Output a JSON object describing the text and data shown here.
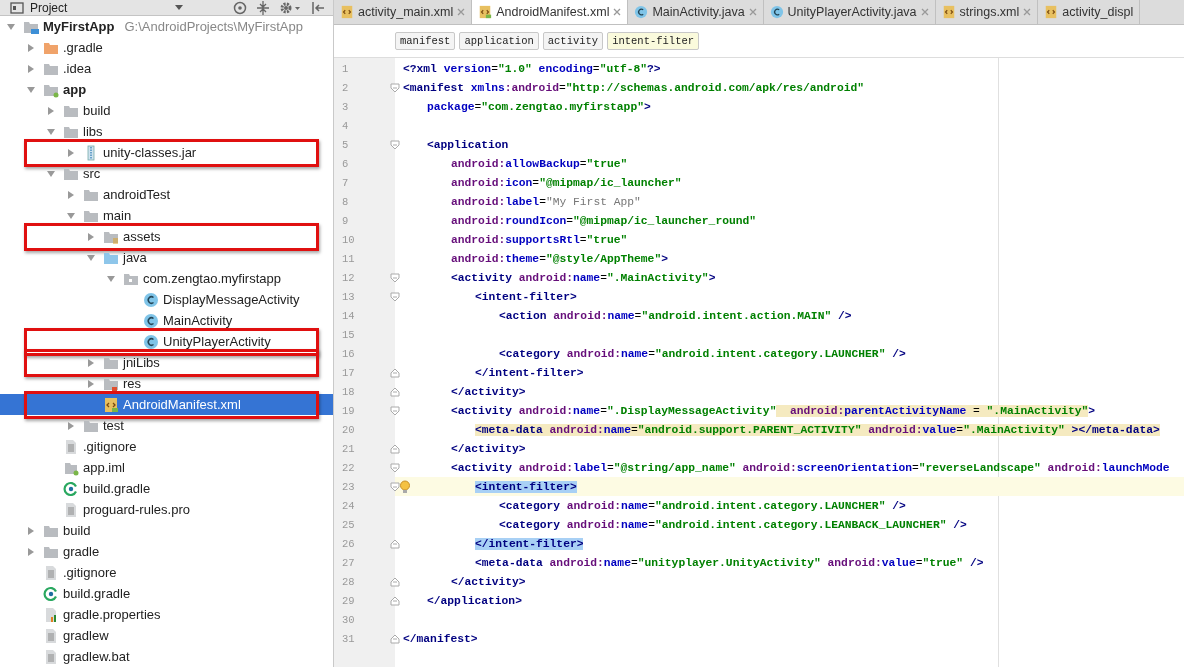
{
  "project_panel": {
    "title": "Project"
  },
  "tree": [
    {
      "label": "MyFirstApp",
      "path": "G:\\AndroidProjects\\MyFirstApp",
      "kind": "project",
      "expanded": true,
      "selected": false,
      "boxed": false,
      "children": [
        {
          "label": ".gradle",
          "kind": "folder-excluded",
          "expanded": false,
          "selected": false,
          "boxed": false
        },
        {
          "label": ".idea",
          "kind": "folder",
          "expanded": false,
          "selected": false,
          "boxed": false
        },
        {
          "label": "app",
          "kind": "module",
          "expanded": true,
          "selected": false,
          "boxed": false,
          "children": [
            {
              "label": "build",
              "kind": "folder",
              "expanded": false,
              "selected": false,
              "boxed": false
            },
            {
              "label": "libs",
              "kind": "folder",
              "expanded": true,
              "selected": false,
              "boxed": false,
              "children": [
                {
                  "label": "unity-classes.jar",
                  "kind": "jar",
                  "expanded": false,
                  "selected": false,
                  "boxed": true
                }
              ]
            },
            {
              "label": "src",
              "kind": "folder",
              "expanded": true,
              "selected": false,
              "boxed": false,
              "children": [
                {
                  "label": "androidTest",
                  "kind": "folder",
                  "expanded": false,
                  "selected": false,
                  "boxed": false
                },
                {
                  "label": "main",
                  "kind": "folder",
                  "expanded": true,
                  "selected": false,
                  "boxed": false,
                  "children": [
                    {
                      "label": "assets",
                      "kind": "assets",
                      "expanded": false,
                      "selected": false,
                      "boxed": true
                    },
                    {
                      "label": "java",
                      "kind": "source",
                      "expanded": true,
                      "selected": false,
                      "boxed": false,
                      "children": [
                        {
                          "label": "com.zengtao.myfirstapp",
                          "kind": "package",
                          "expanded": true,
                          "selected": false,
                          "boxed": false,
                          "children": [
                            {
                              "label": "DisplayMessageActivity",
                              "kind": "class",
                              "selected": false,
                              "boxed": false
                            },
                            {
                              "label": "MainActivity",
                              "kind": "class",
                              "selected": false,
                              "boxed": false
                            },
                            {
                              "label": "UnityPlayerActivity",
                              "kind": "class",
                              "selected": false,
                              "boxed": true
                            }
                          ]
                        }
                      ]
                    },
                    {
                      "label": "jniLibs",
                      "kind": "folder",
                      "expanded": false,
                      "selected": false,
                      "boxed": true
                    },
                    {
                      "label": "res",
                      "kind": "res",
                      "expanded": false,
                      "selected": false,
                      "boxed": false
                    },
                    {
                      "label": "AndroidManifest.xml",
                      "kind": "manifest",
                      "selected": true,
                      "boxed": true
                    }
                  ]
                },
                {
                  "label": "test",
                  "kind": "folder",
                  "expanded": false,
                  "selected": false,
                  "boxed": false
                }
              ]
            },
            {
              "label": ".gitignore",
              "kind": "text",
              "selected": false,
              "boxed": false
            },
            {
              "label": "app.iml",
              "kind": "iml",
              "selected": false,
              "boxed": false
            },
            {
              "label": "build.gradle",
              "kind": "gradle",
              "selected": false,
              "boxed": false
            },
            {
              "label": "proguard-rules.pro",
              "kind": "text",
              "selected": false,
              "boxed": false
            }
          ]
        },
        {
          "label": "build",
          "kind": "folder",
          "expanded": false,
          "selected": false,
          "boxed": false
        },
        {
          "label": "gradle",
          "kind": "folder",
          "expanded": false,
          "selected": false,
          "boxed": false
        },
        {
          "label": ".gitignore",
          "kind": "text",
          "selected": false,
          "boxed": false
        },
        {
          "label": "build.gradle",
          "kind": "gradle",
          "selected": false,
          "boxed": false
        },
        {
          "label": "gradle.properties",
          "kind": "properties",
          "selected": false,
          "boxed": false
        },
        {
          "label": "gradlew",
          "kind": "text",
          "selected": false,
          "boxed": false
        },
        {
          "label": "gradlew.bat",
          "kind": "text",
          "selected": false,
          "boxed": false
        }
      ]
    }
  ],
  "tabs": [
    {
      "label": "activity_main.xml",
      "kind": "xml",
      "selected": false,
      "closable": true
    },
    {
      "label": "AndroidManifest.xml",
      "kind": "manifest",
      "selected": true,
      "closable": true
    },
    {
      "label": "MainActivity.java",
      "kind": "class",
      "selected": false,
      "closable": true
    },
    {
      "label": "UnityPlayerActivity.java",
      "kind": "class",
      "selected": false,
      "closable": true
    },
    {
      "label": "strings.xml",
      "kind": "xml",
      "selected": false,
      "closable": true
    },
    {
      "label": "activity_displ",
      "kind": "xml",
      "selected": false,
      "closable": false
    }
  ],
  "breadcrumbs": [
    {
      "label": "manifest",
      "selected": false
    },
    {
      "label": "application",
      "selected": false
    },
    {
      "label": "activity",
      "selected": false
    },
    {
      "label": "intent-filter",
      "selected": true
    }
  ],
  "code_lines": [
    {
      "number": "1",
      "tokens": [
        {
          "kind": "tag",
          "text": "<?xml"
        },
        {
          "kind": "attr",
          "text": " version"
        },
        {
          "kind": "plain",
          "text": "="
        },
        {
          "kind": "value",
          "text": "\"1.0\""
        },
        {
          "kind": "attr",
          "text": " encoding"
        },
        {
          "kind": "plain",
          "text": "="
        },
        {
          "kind": "value",
          "text": "\"utf-8\""
        },
        {
          "kind": "tag",
          "text": "?>"
        }
      ]
    },
    {
      "number": "2",
      "fold_open": true,
      "tokens": [
        {
          "kind": "tag",
          "text": "<manifest"
        },
        {
          "kind": "attr",
          "text": " xmlns"
        },
        {
          "kind": "ns",
          "text": ":android"
        },
        {
          "kind": "plain",
          "text": "="
        },
        {
          "kind": "value",
          "text": "\"http://schemas.android.com/apk/res/android\""
        }
      ]
    },
    {
      "number": "3",
      "tokens": [
        {
          "kind": "attr",
          "text": "    package"
        },
        {
          "kind": "plain",
          "text": "="
        },
        {
          "kind": "value",
          "text": "\"com.zengtao.myfirstapp\""
        },
        {
          "kind": "tag",
          "text": ">"
        }
      ]
    },
    {
      "number": "4"
    },
    {
      "number": "5",
      "fold_open": true,
      "tokens": [
        {
          "kind": "tag",
          "text": "    <application"
        }
      ]
    },
    {
      "number": "6",
      "tokens": [
        {
          "kind": "ns",
          "text": "        android:"
        },
        {
          "kind": "attr",
          "text": "allowBackup"
        },
        {
          "kind": "plain",
          "text": "="
        },
        {
          "kind": "value",
          "text": "\"true\""
        }
      ]
    },
    {
      "number": "7",
      "tokens": [
        {
          "kind": "ns",
          "text": "        android:"
        },
        {
          "kind": "attr",
          "text": "icon"
        },
        {
          "kind": "plain",
          "text": "="
        },
        {
          "kind": "value",
          "text": "\"@mipmap/ic_launcher\""
        }
      ]
    },
    {
      "number": "8",
      "tokens": [
        {
          "kind": "ns",
          "text": "        android:"
        },
        {
          "kind": "attr",
          "text": "label"
        },
        {
          "kind": "plain",
          "text": "="
        },
        {
          "kind": "literal",
          "text": "\"My First App\""
        }
      ]
    },
    {
      "number": "9",
      "tokens": [
        {
          "kind": "ns",
          "text": "        android:"
        },
        {
          "kind": "attr",
          "text": "roundIcon"
        },
        {
          "kind": "plain",
          "text": "="
        },
        {
          "kind": "value",
          "text": "\"@mipmap/ic_launcher_round\""
        }
      ]
    },
    {
      "number": "10",
      "tokens": [
        {
          "kind": "ns",
          "text": "        android:"
        },
        {
          "kind": "attr",
          "text": "supportsRtl"
        },
        {
          "kind": "plain",
          "text": "="
        },
        {
          "kind": "value",
          "text": "\"true\""
        }
      ]
    },
    {
      "number": "11",
      "tokens": [
        {
          "kind": "ns",
          "text": "        android:"
        },
        {
          "kind": "attr",
          "text": "theme"
        },
        {
          "kind": "plain",
          "text": "="
        },
        {
          "kind": "value",
          "text": "\"@style/AppTheme\""
        },
        {
          "kind": "tag",
          "text": ">"
        }
      ]
    },
    {
      "number": "12",
      "fold_open": true,
      "tokens": [
        {
          "kind": "tag",
          "text": "        <activity"
        },
        {
          "kind": "ns",
          "text": " android:"
        },
        {
          "kind": "attr",
          "text": "name"
        },
        {
          "kind": "plain",
          "text": "="
        },
        {
          "kind": "value",
          "text": "\".MainActivity\""
        },
        {
          "kind": "tag",
          "text": ">"
        }
      ]
    },
    {
      "number": "13",
      "fold_open": true,
      "tokens": [
        {
          "kind": "tag",
          "text": "            <intent-filter>"
        }
      ]
    },
    {
      "number": "14",
      "tokens": [
        {
          "kind": "tag",
          "text": "                <action"
        },
        {
          "kind": "ns",
          "text": " android:"
        },
        {
          "kind": "attr",
          "text": "name"
        },
        {
          "kind": "plain",
          "text": "="
        },
        {
          "kind": "value",
          "text": "\"android.intent.action.MAIN\""
        },
        {
          "kind": "tag",
          "text": " />"
        }
      ]
    },
    {
      "number": "15"
    },
    {
      "number": "16",
      "tokens": [
        {
          "kind": "tag",
          "text": "                <category"
        },
        {
          "kind": "ns",
          "text": " android:"
        },
        {
          "kind": "attr",
          "text": "name"
        },
        {
          "kind": "plain",
          "text": "="
        },
        {
          "kind": "value",
          "text": "\"android.intent.category.LAUNCHER\""
        },
        {
          "kind": "tag",
          "text": " />"
        }
      ]
    },
    {
      "number": "17",
      "fold_open": false,
      "tokens": [
        {
          "kind": "tag",
          "text": "            </intent-filter>"
        }
      ]
    },
    {
      "number": "18",
      "fold_open": false,
      "tokens": [
        {
          "kind": "tag",
          "text": "        </activity>"
        }
      ]
    },
    {
      "number": "19",
      "fold_open": true,
      "tokens": [
        {
          "kind": "tag",
          "text": "        <activity"
        },
        {
          "kind": "ns",
          "text": " android:"
        },
        {
          "kind": "attr",
          "text": "name"
        },
        {
          "kind": "plain",
          "text": "="
        },
        {
          "kind": "value",
          "text": "\".DisplayMessageActivity\""
        },
        {
          "kind": "ns",
          "text": "  android:",
          "warning": true
        },
        {
          "kind": "attr",
          "text": "parentActivityName",
          "warning": true
        },
        {
          "kind": "plain",
          "text": " = ",
          "warning": true
        },
        {
          "kind": "value",
          "text": "\".MainActivity\"",
          "warning": true
        },
        {
          "kind": "tag",
          "text": ">"
        }
      ]
    },
    {
      "number": "20",
      "tokens": [
        {
          "kind": "tag",
          "text": "            <meta-data",
          "warning": true
        },
        {
          "kind": "ns",
          "text": " android:",
          "warning": true
        },
        {
          "kind": "attr",
          "text": "name",
          "warning": true
        },
        {
          "kind": "plain",
          "text": "=",
          "warning": true
        },
        {
          "kind": "value",
          "text": "\"android.support.PARENT_ACTIVITY\"",
          "warning": true
        },
        {
          "kind": "ns",
          "text": " android:",
          "warning": true
        },
        {
          "kind": "attr",
          "text": "value",
          "warning": true
        },
        {
          "kind": "plain",
          "text": "=",
          "warning": true
        },
        {
          "kind": "value",
          "text": "\".MainActivity\"",
          "warning": true
        },
        {
          "kind": "tag",
          "text": " ></meta-data>",
          "warning": true
        }
      ]
    },
    {
      "number": "21",
      "fold_open": false,
      "tokens": [
        {
          "kind": "tag",
          "text": "        </activity>"
        }
      ]
    },
    {
      "number": "22",
      "fold_open": true,
      "tokens": [
        {
          "kind": "tag",
          "text": "        <activity"
        },
        {
          "kind": "ns",
          "text": " android:"
        },
        {
          "kind": "attr",
          "text": "label"
        },
        {
          "kind": "plain",
          "text": "="
        },
        {
          "kind": "value",
          "text": "\"@string/app_name\""
        },
        {
          "kind": "ns",
          "text": " android:"
        },
        {
          "kind": "attr",
          "text": "screenOrientation"
        },
        {
          "kind": "plain",
          "text": "="
        },
        {
          "kind": "value",
          "text": "\"reverseLandscape\""
        },
        {
          "kind": "ns",
          "text": " android:"
        },
        {
          "kind": "attr",
          "text": "launchMode"
        }
      ]
    },
    {
      "number": "23",
      "fold_open": true,
      "current": true,
      "hint": true,
      "tokens": [
        {
          "kind": "tag",
          "text": "            <intent-filter>",
          "matched": true
        }
      ]
    },
    {
      "number": "24",
      "tokens": [
        {
          "kind": "tag",
          "text": "                <category"
        },
        {
          "kind": "ns",
          "text": " android:"
        },
        {
          "kind": "attr",
          "text": "name"
        },
        {
          "kind": "plain",
          "text": "="
        },
        {
          "kind": "value",
          "text": "\"android.intent.category.LAUNCHER\""
        },
        {
          "kind": "tag",
          "text": " />"
        }
      ]
    },
    {
      "number": "25",
      "tokens": [
        {
          "kind": "tag",
          "text": "                <category"
        },
        {
          "kind": "ns",
          "text": " android:"
        },
        {
          "kind": "attr",
          "text": "name"
        },
        {
          "kind": "plain",
          "text": "="
        },
        {
          "kind": "value",
          "text": "\"android.intent.category.LEANBACK_LAUNCHER\""
        },
        {
          "kind": "tag",
          "text": " />"
        }
      ]
    },
    {
      "number": "26",
      "fold_open": false,
      "tokens": [
        {
          "kind": "tag",
          "text": "            </intent-filter>",
          "matched": true
        }
      ]
    },
    {
      "number": "27",
      "tokens": [
        {
          "kind": "tag",
          "text": "            <meta-data"
        },
        {
          "kind": "ns",
          "text": " android:"
        },
        {
          "kind": "attr",
          "text": "name"
        },
        {
          "kind": "plain",
          "text": "="
        },
        {
          "kind": "value",
          "text": "\"unityplayer.UnityActivity\""
        },
        {
          "kind": "ns",
          "text": " android:"
        },
        {
          "kind": "attr",
          "text": "value"
        },
        {
          "kind": "plain",
          "text": "="
        },
        {
          "kind": "value",
          "text": "\"true\""
        },
        {
          "kind": "tag",
          "text": " />"
        }
      ]
    },
    {
      "number": "28",
      "fold_open": false,
      "tokens": [
        {
          "kind": "tag",
          "text": "        </activity>"
        }
      ]
    },
    {
      "number": "29",
      "fold_open": false,
      "tokens": [
        {
          "kind": "tag",
          "text": "    </application>"
        }
      ]
    },
    {
      "number": "30"
    },
    {
      "number": "31",
      "fold_open": false,
      "tokens": [
        {
          "kind": "tag",
          "text": "</manifest>"
        }
      ]
    }
  ]
}
